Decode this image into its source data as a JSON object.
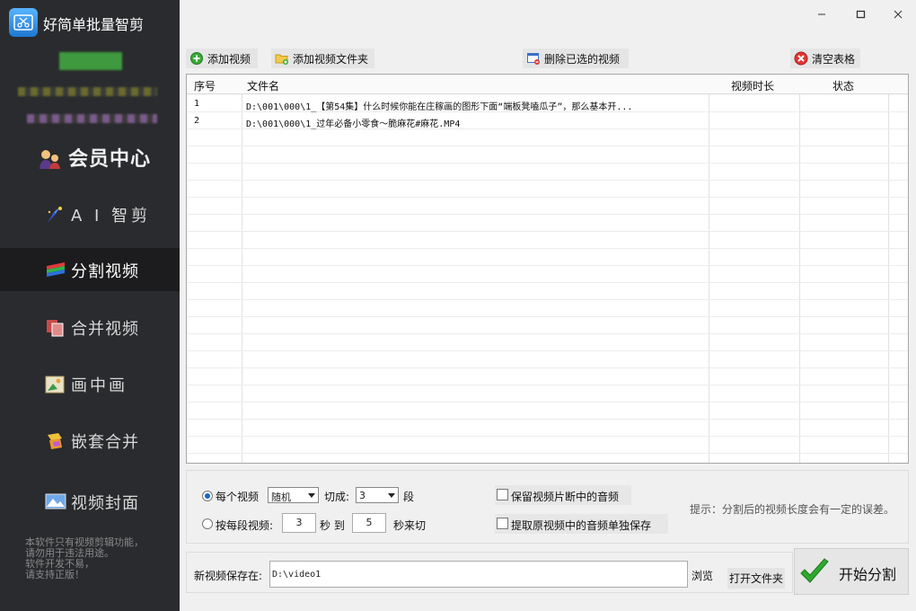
{
  "app": {
    "title": "好简单批量智剪"
  },
  "sidebar": {
    "items": [
      {
        "label": "会员中心",
        "icon": "member-icon"
      },
      {
        "label": "A I 智剪",
        "icon": "ai-icon"
      },
      {
        "label": "分割视频",
        "icon": "split-icon",
        "active": true
      },
      {
        "label": "合并视频",
        "icon": "merge-icon"
      },
      {
        "label": "画中画",
        "icon": "pip-icon"
      },
      {
        "label": "嵌套合并",
        "icon": "nested-merge-icon"
      },
      {
        "label": "视频封面",
        "icon": "cover-icon"
      }
    ],
    "disclaimer": [
      "本软件只有视频剪辑功能，",
      "请勿用于违法用途。",
      "软件开发不易，",
      "请支持正版！"
    ]
  },
  "toolbar": {
    "add_video": "添加视频",
    "add_folder": "添加视频文件夹",
    "delete_selected": "删除已选的视频",
    "clear_table": "清空表格"
  },
  "table": {
    "columns": [
      "序号",
      "文件名",
      "视频时长",
      "状态"
    ],
    "rows": [
      {
        "index": "1",
        "filename": "D:\\001\\000\\1_【第54集】什么时候你能在庄稼画的图形下面“端板凳嗑瓜子”，那么基本开...",
        "duration": "",
        "status": ""
      },
      {
        "index": "2",
        "filename": "D:\\001\\000\\1_过年必备小零食～脆麻花#麻花.MP4",
        "duration": "",
        "status": ""
      }
    ]
  },
  "options": {
    "per_video_label": "每个视频",
    "mode_value": "随机",
    "cut_into_label": "切成:",
    "segments_value": "3",
    "segments_unit": "段",
    "per_segment_label": "按每段视频:",
    "from_seconds": "3",
    "seconds_label": "秒 到",
    "to_seconds": "5",
    "cut_label": "秒来切",
    "keep_audio_label": "保留视频片断中的音频",
    "extract_audio_label": "提取原视频中的音频单独保存",
    "hint": "提示：分割后的视频长度会有一定的误差。"
  },
  "save": {
    "label": "新视频保存在:",
    "path": "D:\\video1",
    "browse": "浏览",
    "open_folder": "打开文件夹"
  },
  "start": {
    "label": "开始分割"
  },
  "colors": {
    "sidebar_bg": "#2a2b2e",
    "sidebar_active_bg": "#1c1c1e",
    "accent_green": "#2fa82f"
  }
}
